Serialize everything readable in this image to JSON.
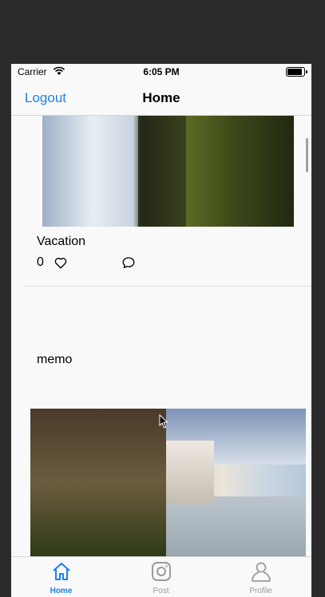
{
  "status_bar": {
    "carrier": "Carrier",
    "time": "6:05 PM",
    "battery_level": 1.0
  },
  "nav": {
    "left_button": "Logout",
    "title": "Home"
  },
  "feed": [
    {
      "caption": "Vacation",
      "likes": "0"
    },
    {
      "caption": "memo"
    }
  ],
  "tabs": [
    {
      "label": "Home",
      "icon": "home-icon",
      "active": true
    },
    {
      "label": "Post",
      "icon": "camera-icon",
      "active": false
    },
    {
      "label": "Profile",
      "icon": "person-icon",
      "active": false
    }
  ],
  "colors": {
    "accent": "#1a83e8",
    "inactive": "#9a9a9a"
  }
}
